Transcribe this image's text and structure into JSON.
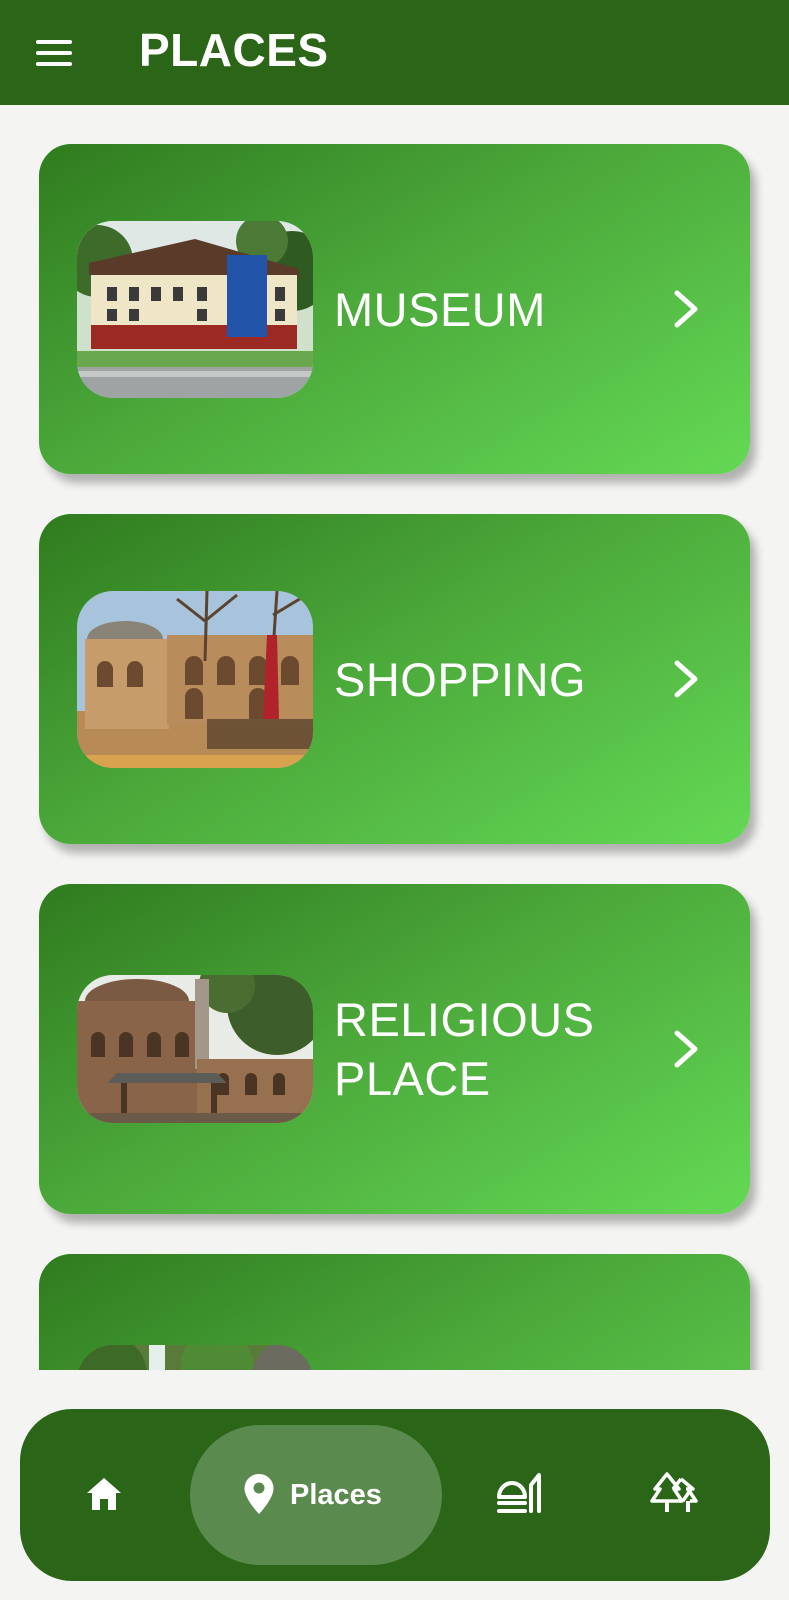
{
  "app_bar": {
    "title": "PLACES",
    "menu_icon": "hamburger-menu-icon",
    "background": "#2b6517"
  },
  "categories": [
    {
      "label": "MUSEUM",
      "image": "museum-photo",
      "chevron_icon": "chevron-right-icon"
    },
    {
      "label": "SHOPPING",
      "image": "shopping-bazaar-photo",
      "chevron_icon": "chevron-right-icon"
    },
    {
      "label": "RELIGIOUS PLACE",
      "image": "mosque-photo",
      "chevron_icon": "chevron-right-icon"
    },
    {
      "label": "",
      "image": "nature-waterfall-photo",
      "chevron_icon": "chevron-right-icon"
    }
  ],
  "card_gradient": [
    "#2f7b1f",
    "#64d955"
  ],
  "bottom_nav": {
    "items": [
      {
        "icon": "home-icon",
        "label": "",
        "selected": false
      },
      {
        "icon": "location-pin-icon",
        "label": "Places",
        "selected": true
      },
      {
        "icon": "food-dish-icon",
        "label": "",
        "selected": false
      },
      {
        "icon": "pine-trees-icon",
        "label": "",
        "selected": false
      }
    ],
    "background": "#2b6517",
    "selected_pill": "#5a8a4e"
  }
}
